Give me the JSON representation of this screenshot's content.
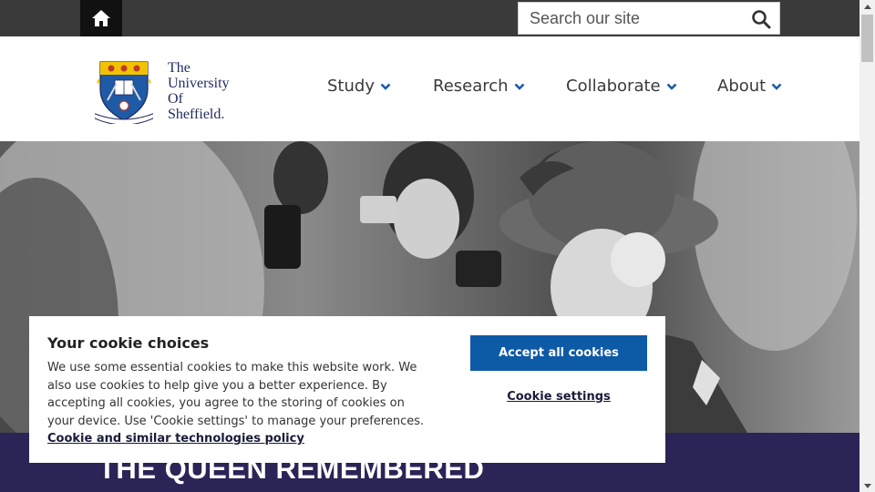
{
  "topbar": {
    "home_icon": "home-icon",
    "search_placeholder": "Search our site",
    "search_icon": "search-icon"
  },
  "logo": {
    "lines": [
      "The",
      "University",
      "Of",
      "Sheffield."
    ]
  },
  "nav": {
    "items": [
      {
        "label": "Study"
      },
      {
        "label": "Research"
      },
      {
        "label": "Collaborate"
      },
      {
        "label": "About"
      }
    ]
  },
  "hero": {
    "banner_title": "THE QUEEN REMEMBERED"
  },
  "cookie": {
    "title": "Your cookie choices",
    "body": "We use some essential cookies to make this website work. We also use cookies to help give you a better experience. By accepting all cookies, you agree to the storing of cookies on your device. Use 'Cookie settings' to manage your preferences.",
    "policy_link": "Cookie and similar technologies policy",
    "accept_label": "Accept all cookies",
    "settings_label": "Cookie settings"
  },
  "colors": {
    "topbar": "#3a3a3a",
    "banner": "#2b2456",
    "accent_blue": "#0d5aa7",
    "nav_chevron": "#1c5ca8"
  }
}
